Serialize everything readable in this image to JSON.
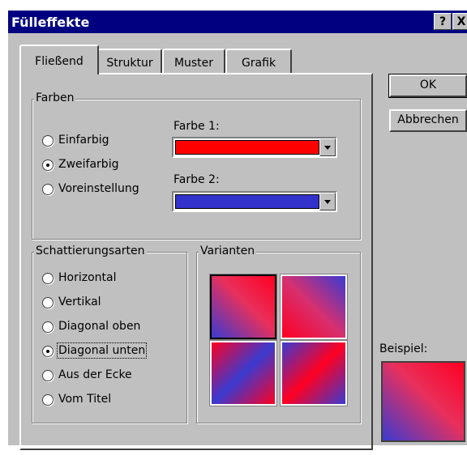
{
  "window": {
    "title": "Fülleffekte",
    "help_button": "?",
    "close_button": "X"
  },
  "tabs": [
    {
      "label": "Fließend",
      "active": true
    },
    {
      "label": "Struktur",
      "active": false
    },
    {
      "label": "Muster",
      "active": false
    },
    {
      "label": "Grafik",
      "active": false
    }
  ],
  "colors_group": {
    "legend": "Farben",
    "options": [
      {
        "label": "Einfarbig",
        "checked": false
      },
      {
        "label": "Zweifarbig",
        "checked": true
      },
      {
        "label": "Voreinstellung",
        "checked": false
      }
    ],
    "color1_label": "Farbe 1:",
    "color1_value": "#ff0000",
    "color2_label": "Farbe 2:",
    "color2_value": "#3333cc"
  },
  "shading_group": {
    "legend": "Schattierungsarten",
    "options": [
      {
        "label": "Horizontal",
        "checked": false
      },
      {
        "label": "Vertikal",
        "checked": false
      },
      {
        "label": "Diagonal oben",
        "checked": false
      },
      {
        "label": "Diagonal unten",
        "checked": true
      },
      {
        "label": "Aus der Ecke",
        "checked": false
      },
      {
        "label": "Vom Titel",
        "checked": false
      }
    ]
  },
  "variants_group": {
    "legend": "Varianten",
    "selected_index": 0,
    "count": 4
  },
  "buttons": {
    "ok": "OK",
    "cancel": "Abbrechen"
  },
  "sample": {
    "label": "Beispiel:"
  }
}
